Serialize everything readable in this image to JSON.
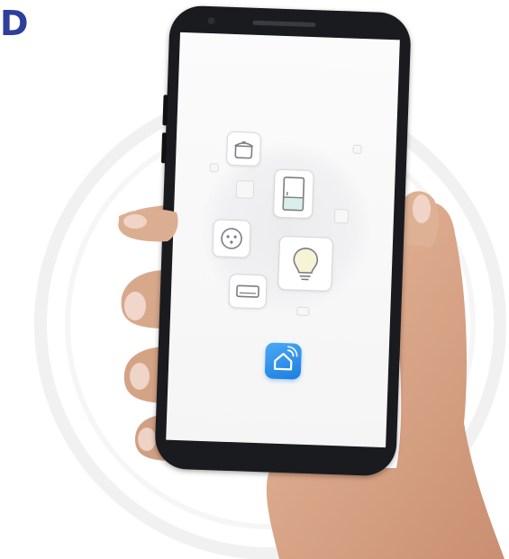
{
  "corner_glyph": "D",
  "icons": {
    "cooker": "rice-cooker-icon",
    "fridge": "refrigerator-icon",
    "socket": "wall-socket-icon",
    "bulb": "light-bulb-icon",
    "ac": "air-conditioner-icon",
    "app": "smart-home-app-icon"
  },
  "colors": {
    "brand_mark": "#2e3e9b",
    "app_icon": "#1d7fe0",
    "phone_body": "#1a1b1f",
    "skin": "#d9a88a"
  }
}
